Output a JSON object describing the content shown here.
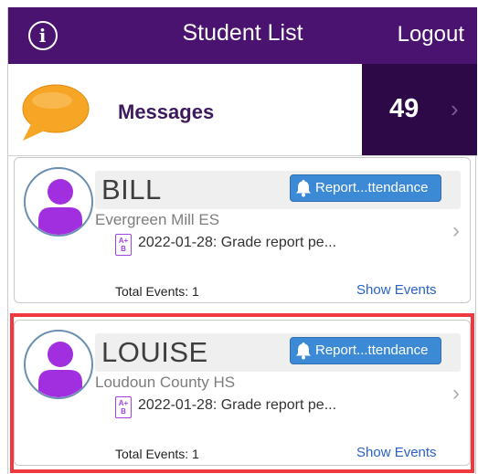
{
  "navbar": {
    "title": "Student List",
    "logout_label": "Logout",
    "info_icon": "i",
    "background": "#4a136f"
  },
  "messages": {
    "label": "Messages",
    "count": "49",
    "chevron": "›",
    "icon": "speech-bubble-icon",
    "bubble_color": "#f6a524"
  },
  "students": [
    {
      "name": "BILL",
      "report_label": "Report...ttendance",
      "school": "Evergreen Mill ES",
      "event_text": "2022-01-28: Grade report pe...",
      "total_events": "Total Events: 1",
      "show_events_label": "Show Events",
      "chevron": "›",
      "grade_icon_text": "A+ B"
    },
    {
      "name": "LOUISE",
      "report_label": "Report...ttendance",
      "school": "Loudoun County HS",
      "event_text": "2022-01-28: Grade report pe...",
      "total_events": "Total Events: 1",
      "show_events_label": "Show Events",
      "chevron": "›",
      "grade_icon_text": "A+ B"
    }
  ],
  "colors": {
    "avatar_purple": "#a12fe0",
    "report_button": "#3c8ad6",
    "highlight": "#ee3a3f",
    "link": "#2a62c9"
  }
}
